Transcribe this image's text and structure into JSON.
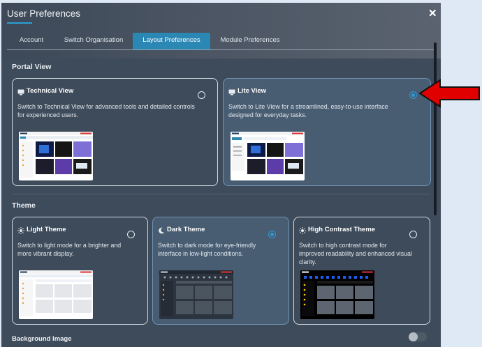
{
  "dialog": {
    "title": "User Preferences",
    "close_label": "✕"
  },
  "tabs": [
    {
      "label": "Account",
      "active": false
    },
    {
      "label": "Switch Organisation",
      "active": false
    },
    {
      "label": "Layout Preferences",
      "active": true
    },
    {
      "label": "Module Preferences",
      "active": false
    }
  ],
  "portal_view": {
    "heading": "Portal View",
    "options": [
      {
        "icon": "monitor-icon",
        "title": "Technical View",
        "description": "Switch to Technical View for advanced tools and detailed controls for experienced users.",
        "selected": false
      },
      {
        "icon": "monitor-icon",
        "title": "Lite View",
        "description": "Switch to Lite View for a streamlined, easy-to-use interface designed for everyday tasks.",
        "selected": true
      }
    ]
  },
  "theme": {
    "heading": "Theme",
    "options": [
      {
        "icon": "sun-icon",
        "title": "Light Theme",
        "description": "Switch to light mode for a brighter and more vibrant display.",
        "selected": false
      },
      {
        "icon": "moon-icon",
        "title": "Dark Theme",
        "description": "Switch to dark mode for eye-friendly interface in low-light conditions.",
        "selected": true
      },
      {
        "icon": "sun-icon",
        "title": "High Contrast Theme",
        "description": "Switch to high contrast mode for improved readability and enhanced visual clarity.",
        "selected": false
      }
    ]
  },
  "background_image": {
    "label": "Background Image",
    "enabled": false
  },
  "colors": {
    "accent": "#2d9bd8",
    "active_tab": "#2b87b4",
    "panel": "#3e4b5a",
    "annotation_arrow": "#e00000"
  }
}
